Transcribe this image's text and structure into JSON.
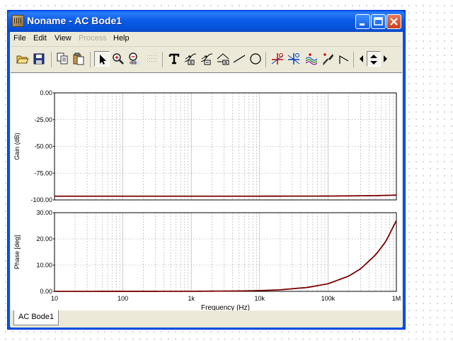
{
  "window": {
    "title": "Noname - AC Bode1",
    "controls": [
      "minimize-icon",
      "maximize-icon",
      "close-icon"
    ]
  },
  "menu": {
    "items": [
      {
        "label": "File",
        "enabled": true
      },
      {
        "label": "Edit",
        "enabled": true
      },
      {
        "label": "View",
        "enabled": true
      },
      {
        "label": "Process",
        "enabled": false
      },
      {
        "label": "Help",
        "enabled": true
      }
    ]
  },
  "toolbar": {
    "tools": [
      {
        "name": "open-icon"
      },
      {
        "name": "save-icon"
      },
      {
        "name": "copy-icon"
      },
      {
        "name": "paste-icon"
      },
      {
        "name": "pointer-icon",
        "pressed": true
      },
      {
        "name": "zoom-in-icon"
      },
      {
        "name": "zoom-100-icon"
      },
      {
        "name": "grid-icon"
      },
      {
        "name": "text-icon"
      },
      {
        "name": "annotation-1-icon"
      },
      {
        "name": "annotation-2-icon"
      },
      {
        "name": "annotation-3-icon"
      },
      {
        "name": "line-icon"
      },
      {
        "name": "circle-icon"
      },
      {
        "name": "cursor-a-icon"
      },
      {
        "name": "cursor-b-icon"
      },
      {
        "name": "waveform-icon"
      },
      {
        "name": "probe-icon"
      },
      {
        "name": "curve-icon"
      },
      {
        "name": "scroll-left-icon"
      },
      {
        "name": "scroll-updown-icon"
      },
      {
        "name": "scroll-right-icon"
      }
    ]
  },
  "tabs": [
    {
      "label": "AC Bode1",
      "active": true
    }
  ],
  "chart_data": [
    {
      "type": "line",
      "title": "",
      "xlabel": "",
      "ylabel": "Gain (dB)",
      "xscale": "log",
      "xlim": [
        10,
        1000000
      ],
      "ylim": [
        -100,
        0
      ],
      "yticks": [
        "0.00",
        "-25.00",
        "-50.00",
        "-75.00",
        "-100.00"
      ],
      "grid": true,
      "series": [
        {
          "color": "#7a0000",
          "x": [
            10,
            100,
            1000,
            10000,
            100000,
            500000,
            1000000
          ],
          "y": [
            -96.5,
            -96.5,
            -96.5,
            -96.5,
            -96.4,
            -96.0,
            -95.5
          ]
        }
      ]
    },
    {
      "type": "line",
      "title": "",
      "xlabel": "Frequency (Hz)",
      "ylabel": "Phase [deg]",
      "xscale": "log",
      "xlim": [
        10,
        1000000
      ],
      "ylim": [
        0,
        30
      ],
      "xticks": [
        "10",
        "100",
        "1k",
        "10k",
        "100k",
        "1M"
      ],
      "yticks": [
        "30.00",
        "20.00",
        "10.00",
        "0.00"
      ],
      "grid": true,
      "series": [
        {
          "color": "#7a0000",
          "x": [
            10,
            1000,
            5000,
            10000,
            20000,
            50000,
            100000,
            200000,
            300000,
            500000,
            700000,
            1000000
          ],
          "y": [
            0,
            0.03,
            0.15,
            0.3,
            0.6,
            1.5,
            2.9,
            5.8,
            8.6,
            14.0,
            19.0,
            27.0
          ]
        }
      ]
    }
  ]
}
